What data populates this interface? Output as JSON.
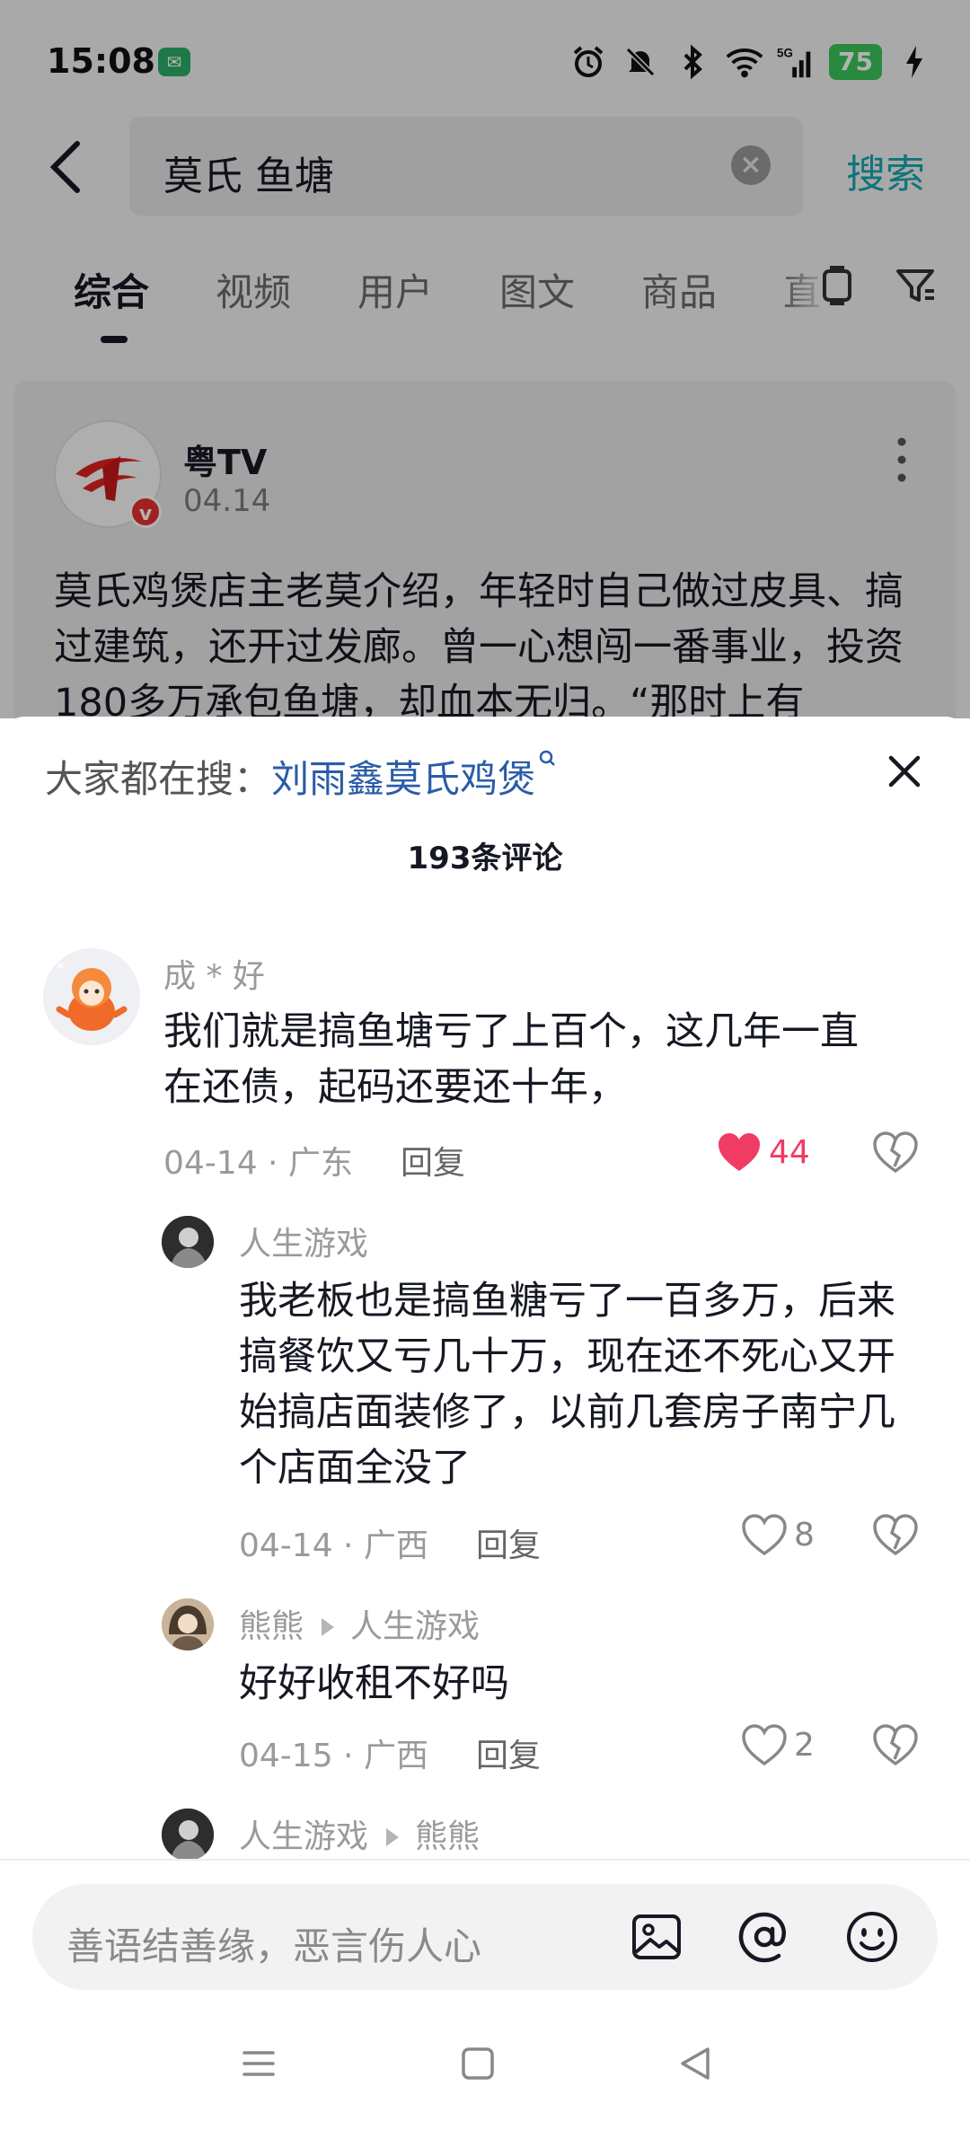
{
  "status_bar": {
    "time": "15:08",
    "battery": "75",
    "network": "5G"
  },
  "search": {
    "query": "莫氏 鱼塘",
    "submit_label": "搜索"
  },
  "tabs": [
    "综合",
    "视频",
    "用户",
    "图文",
    "商品",
    "直"
  ],
  "post": {
    "author": "粤TV",
    "date": "04.14",
    "verified_label": "v",
    "text": "莫氏鸡煲店主老莫介绍，年轻时自己做过皮具、搞过建筑，还开过发廊。曾一心想闯一番事业，投资180多万承包鱼塘，却血本无归。“那时上有"
  },
  "sheet": {
    "trending_prefix": "大家都在搜：",
    "trending_query": "刘雨鑫莫氏鸡煲",
    "comment_count": "193条评论",
    "input_placeholder": "善语结善缘，恶言伤人心"
  },
  "comments": [
    {
      "user": "成 * 好",
      "text_line1": "我们就是搞鱼塘亏了上百个，这几年一直",
      "text_line2": "在还债，起码还要还十年，",
      "meta": "04-14 · 广东",
      "reply_label": "回复",
      "likes": "44"
    },
    {
      "user": "人生游戏",
      "text_line1": "我老板也是搞鱼糖亏了一百多万，后来",
      "text_line2": "搞餐饮又亏几十万，现在还不死心又开",
      "text_line3": "始搞店面装修了，以前几套房子南宁几",
      "text_line4": "个店面全没了",
      "meta": "04-14 · 广西",
      "reply_label": "回复",
      "likes": "8"
    },
    {
      "user": "熊熊",
      "reply_to": "人生游戏",
      "text_line1": "好好收租不好吗",
      "meta": "04-15 · 广西",
      "reply_label": "回复",
      "likes": "2"
    },
    {
      "user": "人生游戏",
      "reply_to": "熊熊"
    }
  ],
  "colors": {
    "accent_teal": "#18a5b1",
    "like_red": "#f03b63",
    "link_blue": "#2a5ca8"
  },
  "icons": [
    "back-icon",
    "clear-icon",
    "layout-icon",
    "filter-icon",
    "more-icon",
    "close-icon",
    "heart-icon",
    "broken-heart-icon",
    "image-icon",
    "at-icon",
    "emoji-icon",
    "menu-icon",
    "home-icon",
    "back-triangle-icon"
  ]
}
